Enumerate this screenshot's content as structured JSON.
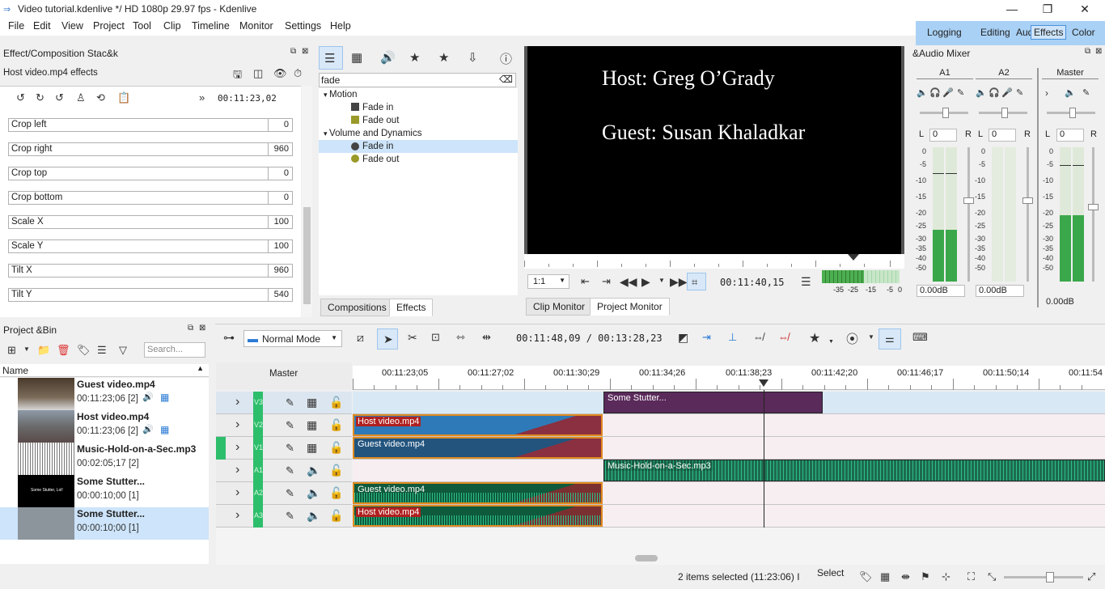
{
  "window": {
    "title": "Video tutorial.kdenlive */ HD 1080p 29.97 fps - Kdenlive",
    "minimize": "—",
    "restore": "❐",
    "close": "✕"
  },
  "menu": [
    "File",
    "Edit",
    "View",
    "Project",
    "Tool",
    "Clip",
    "Timeline",
    "Monitor",
    "Settings",
    "Help"
  ],
  "layouts": [
    "Logging",
    "Editing",
    "Audio",
    "Effects",
    "Color"
  ],
  "effect_stack": {
    "title": "Effect/Composition Stac&k",
    "subtitle": "Host video.mp4 effects",
    "timecode": "00:11:23,02",
    "params": [
      {
        "label": "Crop left",
        "value": "0"
      },
      {
        "label": "Crop right",
        "value": "960"
      },
      {
        "label": "Crop top",
        "value": "0"
      },
      {
        "label": "Crop bottom",
        "value": "0"
      },
      {
        "label": "Scale X",
        "value": "100"
      },
      {
        "label": "Scale Y",
        "value": "100"
      },
      {
        "label": "Tilt X",
        "value": "960"
      },
      {
        "label": "Tilt Y",
        "value": "540"
      }
    ]
  },
  "effects_panel": {
    "search_value": "fade",
    "groups": [
      {
        "name": "Motion",
        "items": [
          "Fade in",
          "Fade out"
        ]
      },
      {
        "name": "Volume and Dynamics",
        "items": [
          "Fade in",
          "Fade out"
        ]
      }
    ],
    "tabs": [
      "Compositions",
      "Effects"
    ]
  },
  "monitor": {
    "line1": "Host: Greg O’Grady",
    "line2": "Guest: Susan Khaladkar",
    "zoom": "1:1",
    "timecode": "00:11:40,15",
    "meter_labels": [
      "-35",
      "-25",
      "-15",
      "-5",
      "0"
    ],
    "tabs": [
      "Clip Monitor",
      "Project Monitor"
    ]
  },
  "audio_mixer": {
    "title": "&Audio Mixer",
    "channels": [
      {
        "name": "A1",
        "pan": "0",
        "db": "0.00dB"
      },
      {
        "name": "A2",
        "pan": "0",
        "db": "0.00dB"
      },
      {
        "name": "Master",
        "pan": "0",
        "db": "0.00dB"
      }
    ],
    "lr": [
      "L",
      "R"
    ],
    "scale": [
      "0",
      "-5",
      "-10",
      "-15",
      "-20",
      "-25",
      "-30",
      "-35",
      "-40",
      "-50"
    ]
  },
  "project_bin": {
    "title": "Project &Bin",
    "search_placeholder": "Search...",
    "column": "Name",
    "items": [
      {
        "name": "Guest video.mp4",
        "duration": "00:11:23;06 [2]"
      },
      {
        "name": "Host video.mp4",
        "duration": "00:11:23;06 [2]"
      },
      {
        "name": "Music-Hold-on-a-Sec.mp3",
        "duration": "00:02:05;17 [2]"
      },
      {
        "name": "Some Stutter...",
        "duration": "00:00:10;00 [1]"
      },
      {
        "name": "Some Stutter...",
        "duration": "00:00:10;00 [1]"
      }
    ],
    "thumb_text": "Some Stutter, Lol!"
  },
  "timeline": {
    "mode": "Normal Mode",
    "position": "00:11:48,09 / 00:13:28,23",
    "master": "Master",
    "ruler": [
      "00:11:23;05",
      "00:11:27;02",
      "00:11:30;29",
      "00:11:34;26",
      "00:11:38;23",
      "00:11:42;20",
      "00:11:46;17",
      "00:11:50;14",
      "00:11:54"
    ],
    "tracks": [
      "V3",
      "V2",
      "V1",
      "A1",
      "A2",
      "A3"
    ],
    "clips": {
      "v3": "Some Stutter...",
      "v2": "Host video.mp4",
      "v1": "Guest video.mp4",
      "a1": "Music-Hold-on-a-Sec.mp3",
      "a2": "Guest video.mp4",
      "a3": "Host video.mp4"
    }
  },
  "status": {
    "text": "2 items selected (11:23:06) I",
    "tool": "Select"
  },
  "colors": {
    "accent": "#a9d1f5",
    "video_clip": "#2e7ab8",
    "audio_clip": "#1e8a62",
    "title_clip": "#5a2a5a",
    "track_green": "#2dbe6c"
  }
}
